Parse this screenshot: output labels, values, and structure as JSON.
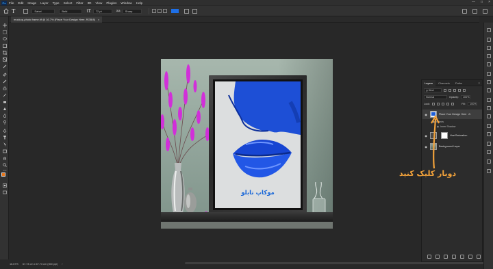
{
  "app": {
    "logo": "Ps"
  },
  "menu": {
    "items": [
      "File",
      "Edit",
      "Image",
      "Layer",
      "Type",
      "Select",
      "Filter",
      "3D",
      "View",
      "Plugins",
      "Window",
      "Help"
    ]
  },
  "options": {
    "font_family": "Sahel",
    "font_style": "Bold",
    "font_size": "72 pt",
    "antialias": "Sharp",
    "text_color": "#1e6fe6"
  },
  "document": {
    "tab_title": "mockup-photo frame.tif @ 16.7% (Place Your Design Here, RGB/8)",
    "tab_close": "×"
  },
  "canvas": {
    "poster_caption": "موکاپ تابلو"
  },
  "status": {
    "zoom": "16.67%",
    "doc_info": "67.73 cm x 67.73 cm (300 ppi)"
  },
  "layers_panel": {
    "tabs": [
      "Layers",
      "Channels",
      "Paths"
    ],
    "kind_label": "Kind",
    "blend_mode": "Normal",
    "opacity_label": "Opacity:",
    "opacity_value": "100%",
    "lock_label": "Lock:",
    "fill_label": "Fill:",
    "fill_value": "100%",
    "layers": [
      {
        "name": "Place Your Design Here",
        "selected": true,
        "thumb": "blue",
        "fx": "fx"
      },
      {
        "name": "Hue/Saturation",
        "selected": false,
        "thumb": "white"
      },
      {
        "name": "Background Layer",
        "selected": false,
        "thumb": "photo"
      }
    ],
    "effects_label": "Effects",
    "effect_item": "Inner Shadow"
  },
  "annotation": {
    "text": "دوبار کلیک کنید",
    "color": "#f2a23b"
  }
}
